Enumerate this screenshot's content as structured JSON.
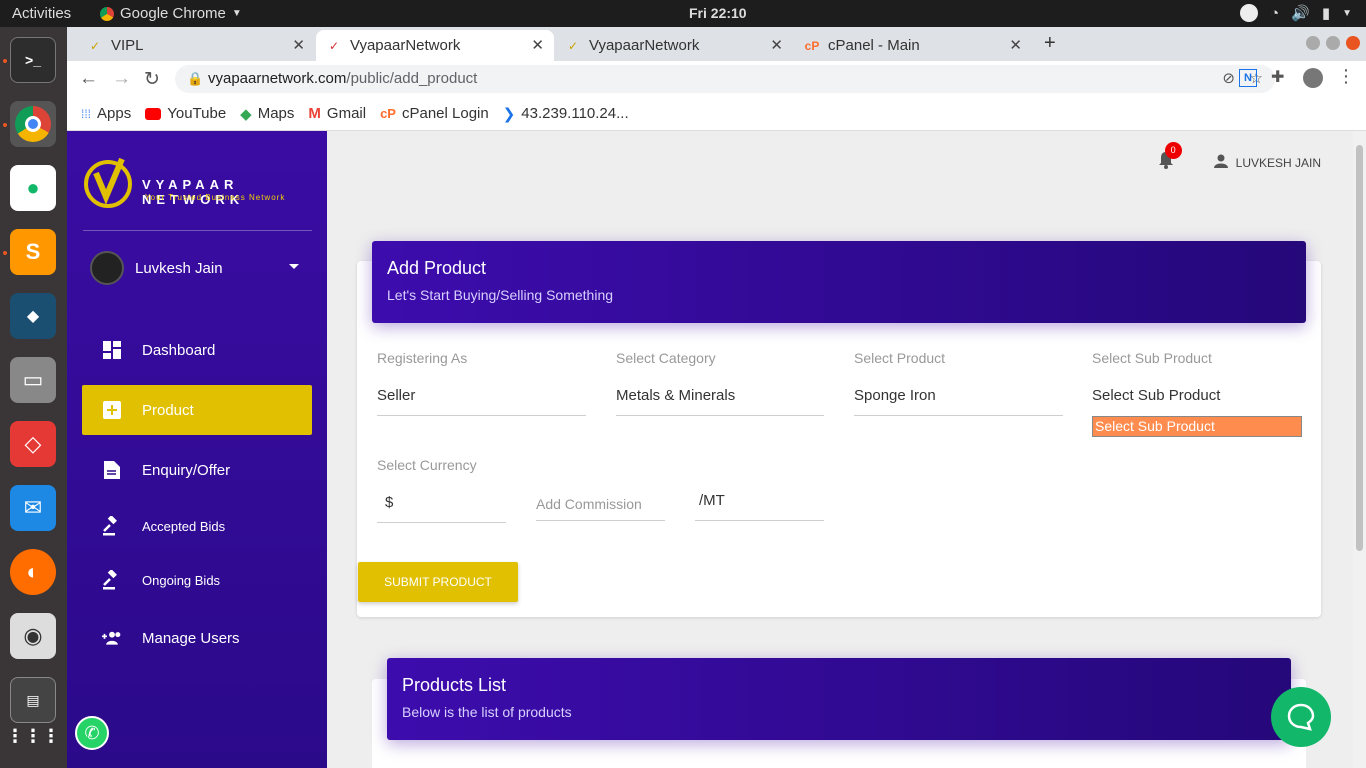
{
  "os": {
    "activities": "Activities",
    "app_name": "Google Chrome",
    "clock": "Fri 22:10"
  },
  "tabs": [
    {
      "label": "VIPL"
    },
    {
      "label": "VyapaarNetwork"
    },
    {
      "label": "VyapaarNetwork"
    },
    {
      "label": "cPanel - Main"
    }
  ],
  "address": {
    "host": "vyapaarnetwork.com",
    "path": "/public/add_product"
  },
  "bookmarks": [
    {
      "label": "Apps"
    },
    {
      "label": "YouTube"
    },
    {
      "label": "Maps"
    },
    {
      "label": "Gmail"
    },
    {
      "label": "cPanel Login"
    },
    {
      "label": "43.239.110.24..."
    }
  ],
  "sidebar": {
    "logo_title": "VYAPAAR NETWORK",
    "logo_subtitle": "Your Trusted Business Network",
    "user_name": "Luvkesh Jain",
    "items": [
      {
        "label": "Dashboard"
      },
      {
        "label": "Product"
      },
      {
        "label": "Enquiry/Offer"
      },
      {
        "label": "Accepted Bids"
      },
      {
        "label": "Ongoing Bids"
      },
      {
        "label": "Manage Users"
      }
    ]
  },
  "header": {
    "notification_count": "0",
    "user_name": "LUVKESH JAIN"
  },
  "form": {
    "title": "Add Product",
    "subtitle": "Let's Start Buying/Selling Something",
    "registering_as_label": "Registering As",
    "registering_as_value": "Seller",
    "category_label": "Select Category",
    "category_value": "Metals & Minerals",
    "product_label": "Select Product",
    "product_value": "Sponge Iron",
    "sub_product_label": "Select Sub Product",
    "sub_product_value": "Select Sub Product",
    "sub_product_option": "Select Sub Product",
    "currency_label": "Select Currency",
    "currency_value": "$",
    "commission_placeholder": "Add Commission",
    "unit_value": "/MT",
    "submit_label": "SUBMIT PRODUCT"
  },
  "products_list": {
    "title": "Products List",
    "subtitle": "Below is the list of products"
  },
  "colors": {
    "sidebar": "#3a0ca3",
    "accent": "#e0c000",
    "highlight": "#ff8c4f"
  }
}
